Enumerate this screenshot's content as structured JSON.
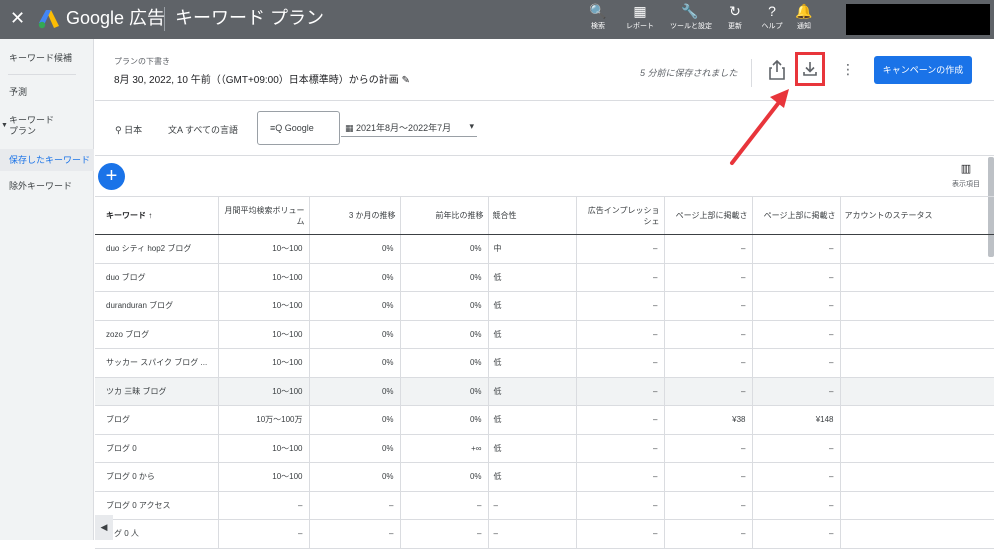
{
  "topbar": {
    "close_glyph": "✕",
    "brand": "Google 広告",
    "title": "キーワード プラン",
    "icons": [
      {
        "icon": "search-icon",
        "glyph": "🔍",
        "label": "検索"
      },
      {
        "icon": "report-icon",
        "glyph": "▦",
        "label": "レポート"
      },
      {
        "icon": "wrench-icon",
        "glyph": "🔧",
        "label": "ツールと設定"
      },
      {
        "icon": "refresh-icon",
        "glyph": "↻",
        "label": "更新"
      },
      {
        "icon": "help-icon",
        "glyph": "?",
        "label": "ヘルプ"
      },
      {
        "icon": "bell-icon",
        "glyph": "🔔",
        "label": "通知"
      }
    ]
  },
  "sidebar": {
    "items": [
      {
        "label": "キーワード候補"
      },
      {
        "label": "予測"
      },
      {
        "label": "キーワード\nプラン"
      },
      {
        "label": "保存したキーワード"
      },
      {
        "label": "除外キーワード"
      }
    ]
  },
  "plan": {
    "subtitle": "プランの下書き",
    "title": "8月 30, 2022, 10 午前（（GMT+09:00）日本標準時）からの計画 ✎",
    "saved_status": "5 分前に保存されました",
    "more_glyph": "⋮",
    "campaign_button": "キャンペーンの作成"
  },
  "filters": {
    "location": "日本",
    "language": "すべての言語",
    "network": "Google",
    "date_range": "2021年8月～2022年7月",
    "location_glyph": "⚲",
    "language_glyph": "文A",
    "network_glyph": "≡Q",
    "date_glyph": "▦",
    "dropdown_glyph": "▾"
  },
  "fab_glyph": "+",
  "columns_button": {
    "glyph": "▥",
    "label": "表示項目"
  },
  "table": {
    "headers": [
      "キーワード ↑",
      "月間平均検索ボリューム",
      "3 か月の推移",
      "前年比の推移",
      "競合性",
      "広告インプレッショ\nシェ",
      "ページ上部に掲載さ",
      "ページ上部に掲載さ",
      "アカウントのステータス"
    ],
    "rows": [
      [
        "duo シティ hop2 ブログ",
        "10～100",
        "0%",
        "0%",
        "中",
        "–",
        "–",
        "–",
        ""
      ],
      [
        "duo ブログ",
        "10～100",
        "0%",
        "0%",
        "低",
        "–",
        "–",
        "–",
        ""
      ],
      [
        "duranduran ブログ",
        "10～100",
        "0%",
        "0%",
        "低",
        "–",
        "–",
        "–",
        ""
      ],
      [
        "zozo ブログ",
        "10～100",
        "0%",
        "0%",
        "低",
        "–",
        "–",
        "–",
        ""
      ],
      [
        "サッカー スパイク ブログ ...",
        "10～100",
        "0%",
        "0%",
        "低",
        "–",
        "–",
        "–",
        ""
      ],
      [
        "ツカ 三昧 ブログ",
        "10～100",
        "0%",
        "0%",
        "低",
        "–",
        "–",
        "–",
        ""
      ],
      [
        "ブログ",
        "10万～100万",
        "0%",
        "0%",
        "低",
        "–",
        "¥38",
        "¥148",
        ""
      ],
      [
        "ブログ 0",
        "10～100",
        "0%",
        "+∞",
        "低",
        "–",
        "–",
        "–",
        ""
      ],
      [
        "ブログ 0 から",
        "10～100",
        "0%",
        "0%",
        "低",
        "–",
        "–",
        "–",
        ""
      ],
      [
        "ブログ 0 アクセス",
        "–",
        "–",
        "–",
        "–",
        "–",
        "–",
        "–",
        ""
      ],
      [
        "ログ 0 人",
        "–",
        "–",
        "–",
        "–",
        "–",
        "–",
        "–",
        ""
      ]
    ]
  },
  "scroll_left_glyph": "◀",
  "colors": {
    "accent": "#1a73e8",
    "topbar": "#5f6368",
    "highlight": "#e8353b"
  }
}
